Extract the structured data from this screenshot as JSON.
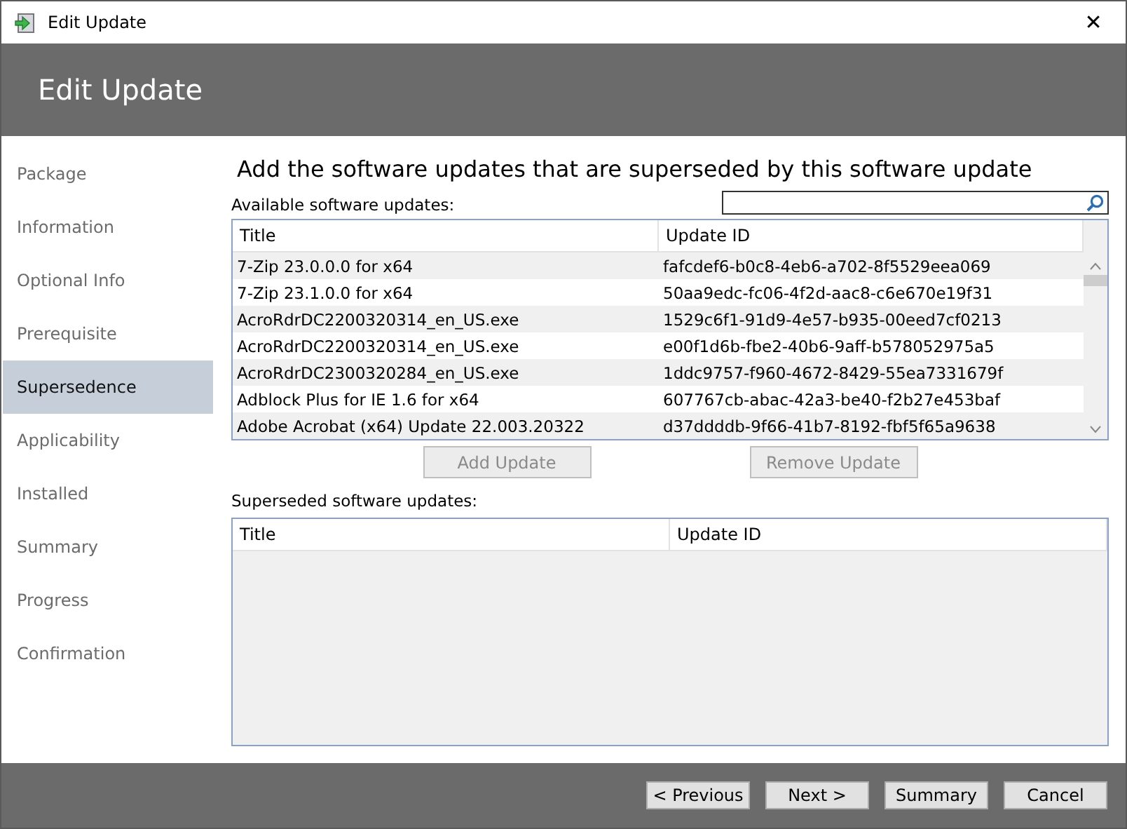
{
  "window": {
    "title": "Edit Update",
    "close": "✕"
  },
  "header": {
    "title": "Edit Update"
  },
  "sidebar": {
    "items": [
      {
        "label": "Package",
        "selected": false
      },
      {
        "label": "Information",
        "selected": false
      },
      {
        "label": "Optional Info",
        "selected": false
      },
      {
        "label": "Prerequisite",
        "selected": false
      },
      {
        "label": "Supersedence",
        "selected": true
      },
      {
        "label": "Applicability",
        "selected": false
      },
      {
        "label": "Installed",
        "selected": false
      },
      {
        "label": "Summary",
        "selected": false
      },
      {
        "label": "Progress",
        "selected": false
      },
      {
        "label": "Confirmation",
        "selected": false
      }
    ]
  },
  "heading": "Add the software updates that are superseded by this software update",
  "available": {
    "label": "Available software updates:",
    "columns": [
      "Title",
      "Update ID"
    ],
    "rows": [
      [
        "7-Zip 23.0.0.0 for x64",
        "fafcdef6-b0c8-4eb6-a702-8f5529eea069"
      ],
      [
        "7-Zip 23.1.0.0 for x64",
        "50aa9edc-fc06-4f2d-aac8-c6e670e19f31"
      ],
      [
        "AcroRdrDC2200320314_en_US.exe",
        "1529c6f1-91d9-4e57-b935-00eed7cf0213"
      ],
      [
        "AcroRdrDC2200320314_en_US.exe",
        "e00f1d6b-fbe2-40b6-9aff-b578052975a5"
      ],
      [
        "AcroRdrDC2300320284_en_US.exe",
        "1ddc9757-f960-4672-8429-55ea7331679f"
      ],
      [
        "Adblock Plus for IE 1.6 for x64",
        "607767cb-abac-42a3-be40-f2b27e453baf"
      ],
      [
        "Adobe Acrobat (x64) Update 22.003.20322",
        "d37ddddb-9f66-41b7-8192-fbf5f65a9638"
      ]
    ]
  },
  "actions": [
    {
      "label": "Add Update",
      "disabled": true
    },
    {
      "label": "Remove Update",
      "disabled": true
    }
  ],
  "superseded": {
    "label": "Superseded software updates:",
    "columns": [
      "Title",
      "Update ID"
    ]
  },
  "footer_buttons": [
    "< Previous",
    "Next >",
    "Summary",
    "Cancel"
  ]
}
